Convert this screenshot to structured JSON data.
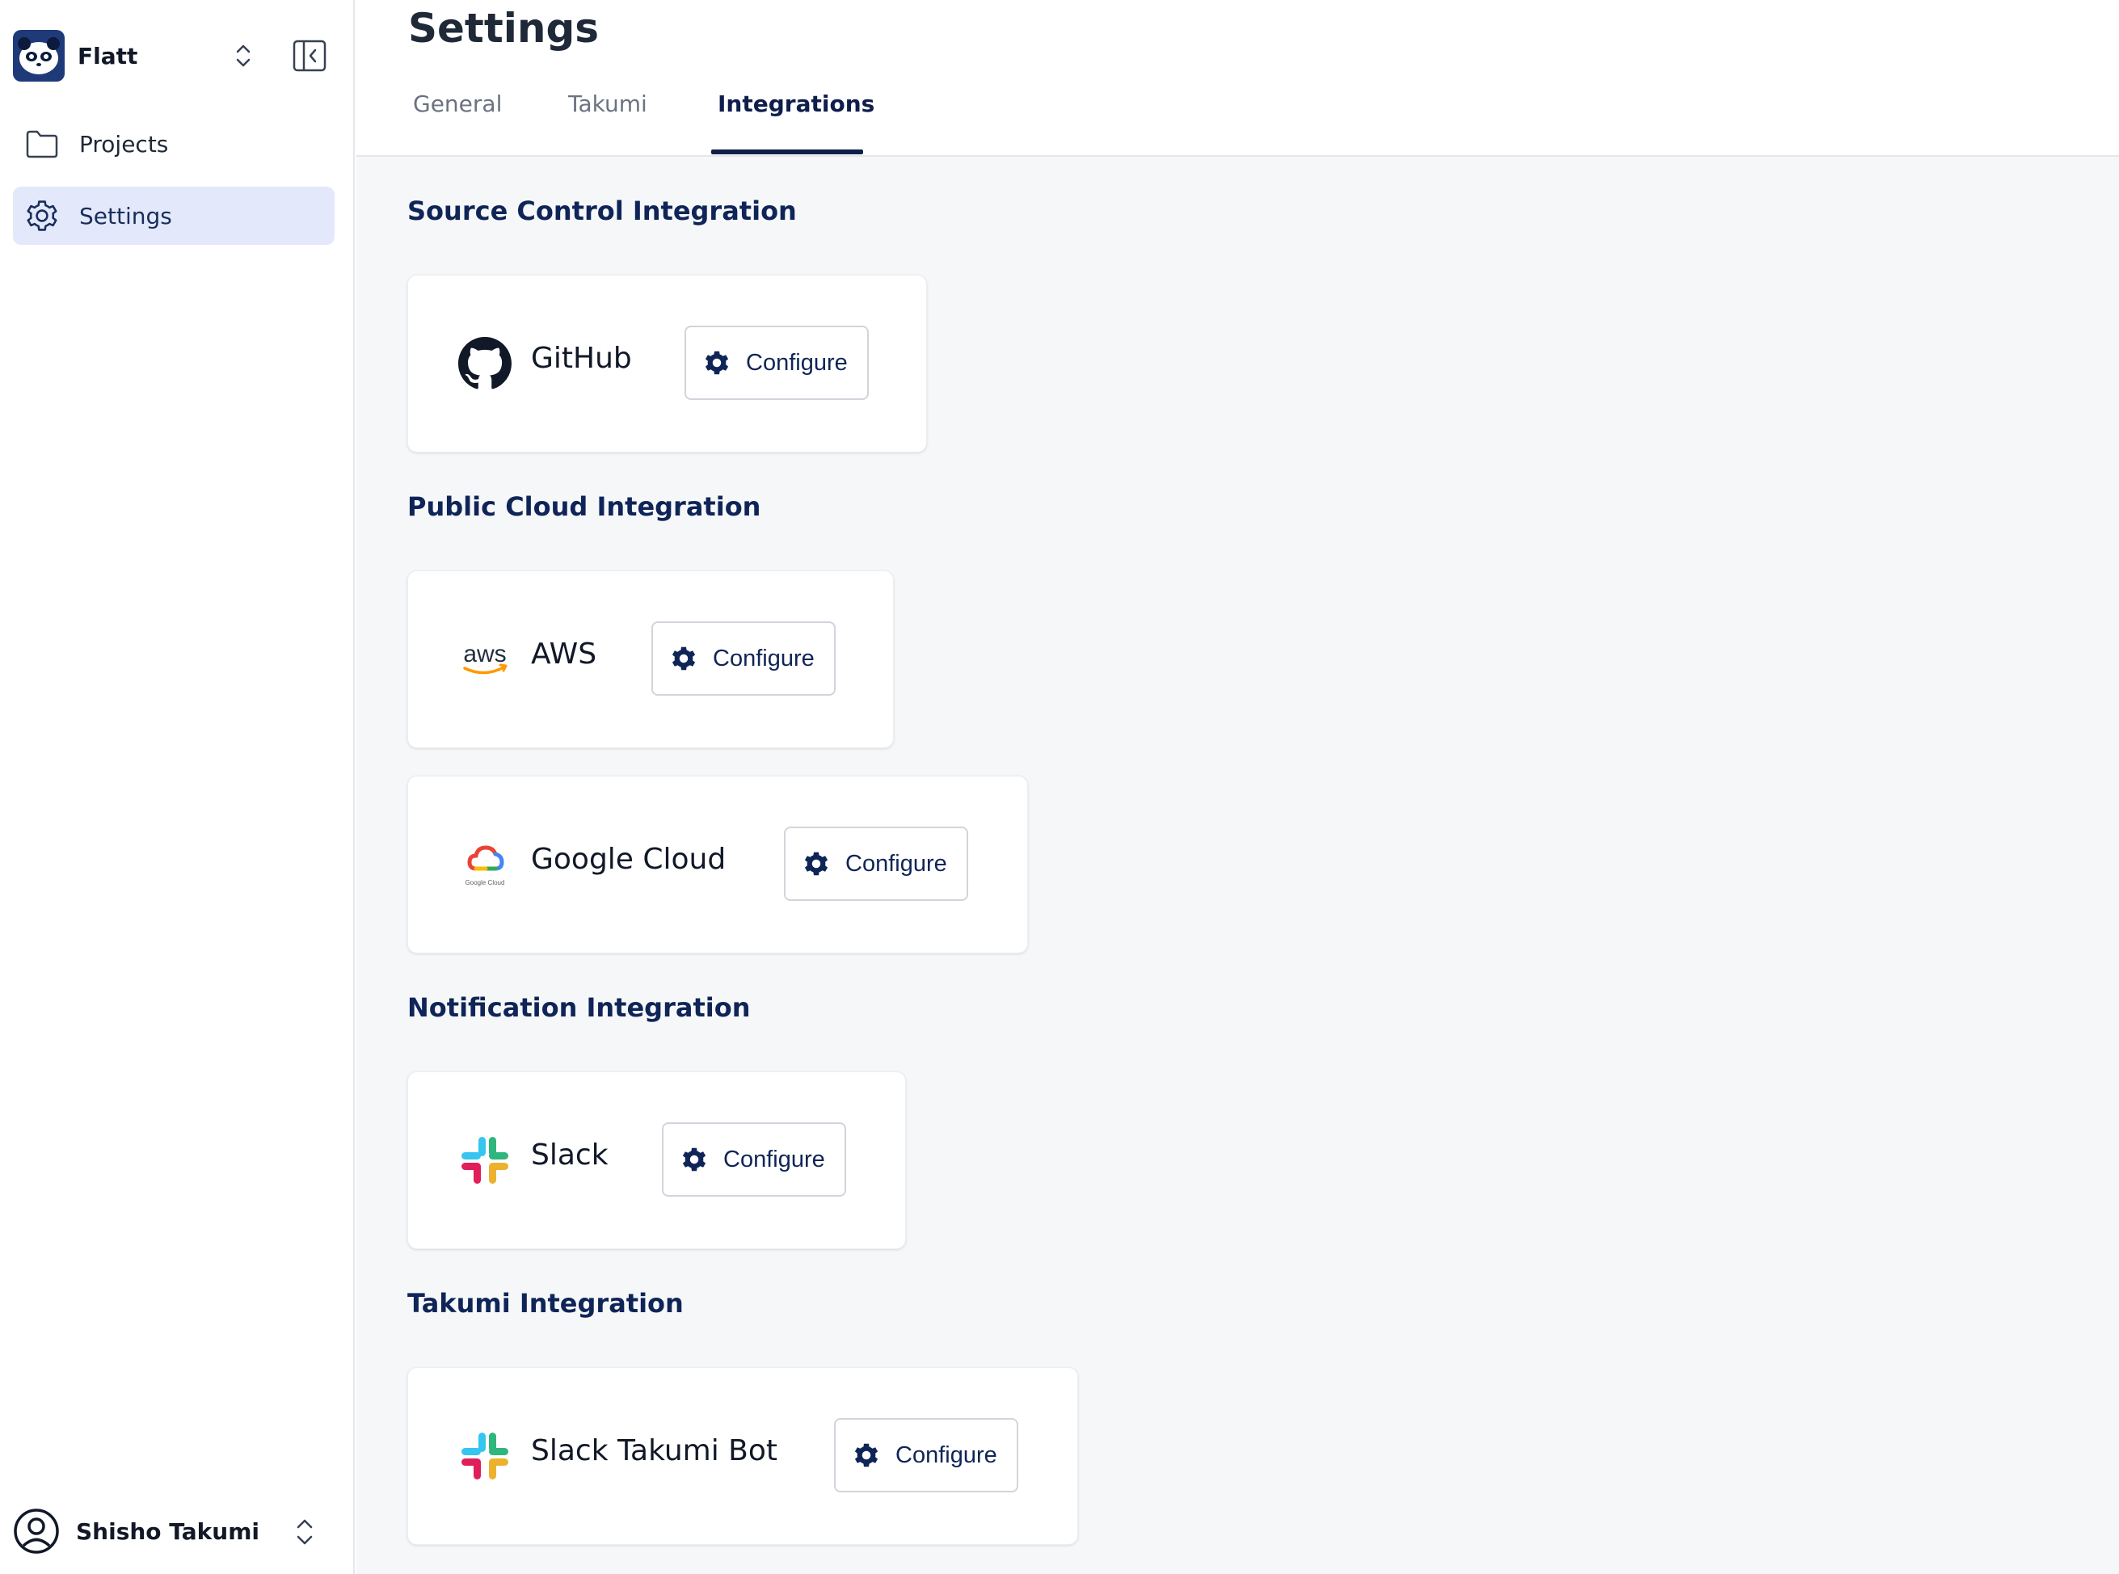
{
  "sidebar": {
    "org_name": "Flatt",
    "nav": [
      {
        "label": "Projects",
        "icon": "folder-icon"
      },
      {
        "label": "Settings",
        "icon": "gear-icon"
      }
    ],
    "user_name": "Shisho Takumi"
  },
  "header": {
    "title": "Settings",
    "tabs": [
      "General",
      "Takumi",
      "Integrations"
    ],
    "active_tab": "Integrations"
  },
  "sections": [
    {
      "title": "Source Control Integration",
      "cards": [
        {
          "name": "GitHub",
          "button": "Configure",
          "icon": "github-icon"
        }
      ]
    },
    {
      "title": "Public Cloud Integration",
      "cards": [
        {
          "name": "AWS",
          "button": "Configure",
          "icon": "aws-icon",
          "logo_text": "aws"
        },
        {
          "name": "Google Cloud",
          "button": "Configure",
          "icon": "google-cloud-icon",
          "logo_text": "Google Cloud"
        }
      ]
    },
    {
      "title": "Notification Integration",
      "cards": [
        {
          "name": "Slack",
          "button": "Configure",
          "icon": "slack-icon"
        }
      ]
    },
    {
      "title": "Takumi Integration",
      "cards": [
        {
          "name": "Slack Takumi Bot",
          "button": "Configure",
          "icon": "slack-icon"
        }
      ]
    }
  ],
  "colors": {
    "primary_navy": "#0f2557",
    "active_nav_bg": "#e3e9fb",
    "content_bg": "#f6f7f9"
  }
}
